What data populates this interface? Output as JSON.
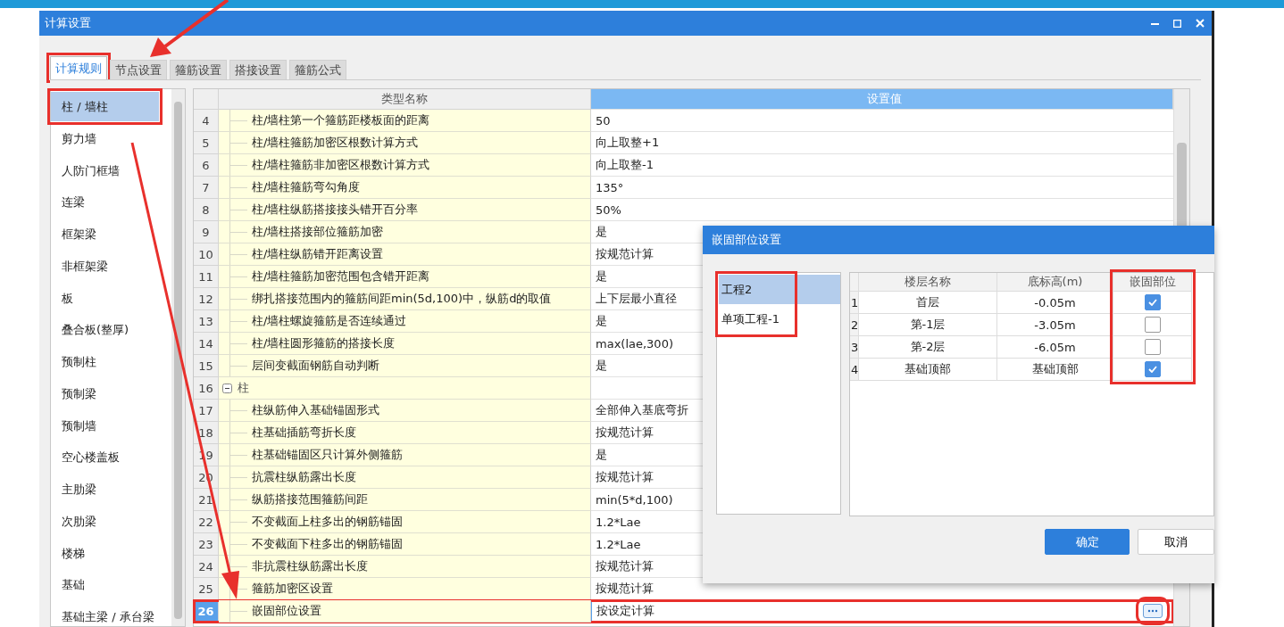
{
  "window": {
    "title": "计算设置"
  },
  "tabs": [
    {
      "label": "计算规则",
      "selected": true,
      "marked": true
    },
    {
      "label": "节点设置",
      "selected": false
    },
    {
      "label": "箍筋设置",
      "selected": false
    },
    {
      "label": "搭接设置",
      "selected": false
    },
    {
      "label": "箍筋公式",
      "selected": false
    }
  ],
  "sidebar": {
    "items": [
      {
        "label": "柱 / 墙柱",
        "selected": true,
        "marked": true
      },
      {
        "label": "剪力墙",
        "selected": false
      },
      {
        "label": "人防门框墙",
        "selected": false
      },
      {
        "label": "连梁",
        "selected": false
      },
      {
        "label": "框架梁",
        "selected": false
      },
      {
        "label": "非框架梁",
        "selected": false
      },
      {
        "label": "板",
        "selected": false
      },
      {
        "label": "叠合板(整厚)",
        "selected": false
      },
      {
        "label": "预制柱",
        "selected": false
      },
      {
        "label": "预制梁",
        "selected": false
      },
      {
        "label": "预制墙",
        "selected": false
      },
      {
        "label": "空心楼盖板",
        "selected": false
      },
      {
        "label": "主肋梁",
        "selected": false
      },
      {
        "label": "次肋梁",
        "selected": false
      },
      {
        "label": "楼梯",
        "selected": false
      },
      {
        "label": "基础",
        "selected": false
      },
      {
        "label": "基础主梁 / 承台梁",
        "selected": false
      }
    ]
  },
  "table": {
    "columns": [
      "类型名称",
      "设置值"
    ],
    "rows": [
      {
        "kind": "item",
        "number": "4",
        "name": "柱/墙柱第一个箍筋距楼板面的距离",
        "value": "50",
        "selected": false
      },
      {
        "kind": "item",
        "number": "5",
        "name": "柱/墙柱箍筋加密区根数计算方式",
        "value": "向上取整+1",
        "selected": false
      },
      {
        "kind": "item",
        "number": "6",
        "name": "柱/墙柱箍筋非加密区根数计算方式",
        "value": "向上取整-1",
        "selected": false
      },
      {
        "kind": "item",
        "number": "7",
        "name": "柱/墙柱箍筋弯勾角度",
        "value": "135°",
        "selected": false
      },
      {
        "kind": "item",
        "number": "8",
        "name": "柱/墙柱纵筋搭接接头错开百分率",
        "value": "50%",
        "selected": false
      },
      {
        "kind": "item",
        "number": "9",
        "name": "柱/墙柱搭接部位箍筋加密",
        "value": "是",
        "selected": false
      },
      {
        "kind": "item",
        "number": "10",
        "name": "柱/墙柱纵筋错开距离设置",
        "value": "按规范计算",
        "selected": false
      },
      {
        "kind": "item",
        "number": "11",
        "name": "柱/墙柱箍筋加密范围包含错开距离",
        "value": "是",
        "selected": false
      },
      {
        "kind": "item",
        "number": "12",
        "name": "绑扎搭接范围内的箍筋间距min(5d,100)中，纵筋d的取值",
        "value": "上下层最小直径",
        "selected": false
      },
      {
        "kind": "item",
        "number": "13",
        "name": "柱/墙柱螺旋箍筋是否连续通过",
        "value": "是",
        "selected": false
      },
      {
        "kind": "item",
        "number": "14",
        "name": "柱/墙柱圆形箍筋的搭接长度",
        "value": "max(lae,300)",
        "selected": false
      },
      {
        "kind": "item",
        "number": "15",
        "name": "层间变截面钢筋自动判断",
        "value": "是",
        "selected": false
      },
      {
        "kind": "group",
        "number": "16",
        "name": "柱",
        "expanded": true,
        "selected": false
      },
      {
        "kind": "item",
        "number": "17",
        "name": "柱纵筋伸入基础锚固形式",
        "value": "全部伸入基底弯折",
        "selected": false
      },
      {
        "kind": "item",
        "number": "18",
        "name": "柱基础插筋弯折长度",
        "value": "按规范计算",
        "selected": false
      },
      {
        "kind": "item",
        "number": "19",
        "name": "柱基础锚固区只计算外侧箍筋",
        "value": "是",
        "selected": false
      },
      {
        "kind": "item",
        "number": "20",
        "name": "抗震柱纵筋露出长度",
        "value": "按规范计算",
        "selected": false
      },
      {
        "kind": "item",
        "number": "21",
        "name": "纵筋搭接范围箍筋间距",
        "value": "min(5*d,100)",
        "selected": false
      },
      {
        "kind": "item",
        "number": "22",
        "name": "不变截面上柱多出的钢筋锚固",
        "value": "1.2*Lae",
        "selected": false
      },
      {
        "kind": "item",
        "number": "23",
        "name": "不变截面下柱多出的钢筋锚固",
        "value": "1.2*Lae",
        "selected": false
      },
      {
        "kind": "item",
        "number": "24",
        "name": "非抗震柱纵筋露出长度",
        "value": "按规范计算",
        "selected": false
      },
      {
        "kind": "item",
        "number": "25",
        "name": "箍筋加密区设置",
        "value": "按规范计算",
        "selected": false
      },
      {
        "kind": "item",
        "number": "26",
        "name": "嵌固部位设置",
        "value": "按设定计算",
        "selected": true,
        "marked": true
      }
    ]
  },
  "dialog": {
    "title": "嵌固部位设置",
    "projects": [
      {
        "label": "工程2",
        "selected": true
      },
      {
        "label": "单项工程-1",
        "selected": false
      }
    ],
    "projects_marked": true,
    "columns": [
      "楼层名称",
      "底标高(m)",
      "嵌固部位"
    ],
    "check_column_marked": true,
    "rows": [
      {
        "number": "1",
        "floor": "首层",
        "elevation": "-0.05m",
        "checked": true
      },
      {
        "number": "2",
        "floor": "第-1层",
        "elevation": "-3.05m",
        "checked": false
      },
      {
        "number": "3",
        "floor": "第-2层",
        "elevation": "-6.05m",
        "checked": false
      },
      {
        "number": "4",
        "floor": "基础顶部",
        "elevation": "基础顶部",
        "checked": true
      }
    ],
    "buttons": [
      {
        "label": "确定",
        "kind": "primary"
      },
      {
        "label": "取消",
        "kind": "secondary"
      }
    ]
  }
}
